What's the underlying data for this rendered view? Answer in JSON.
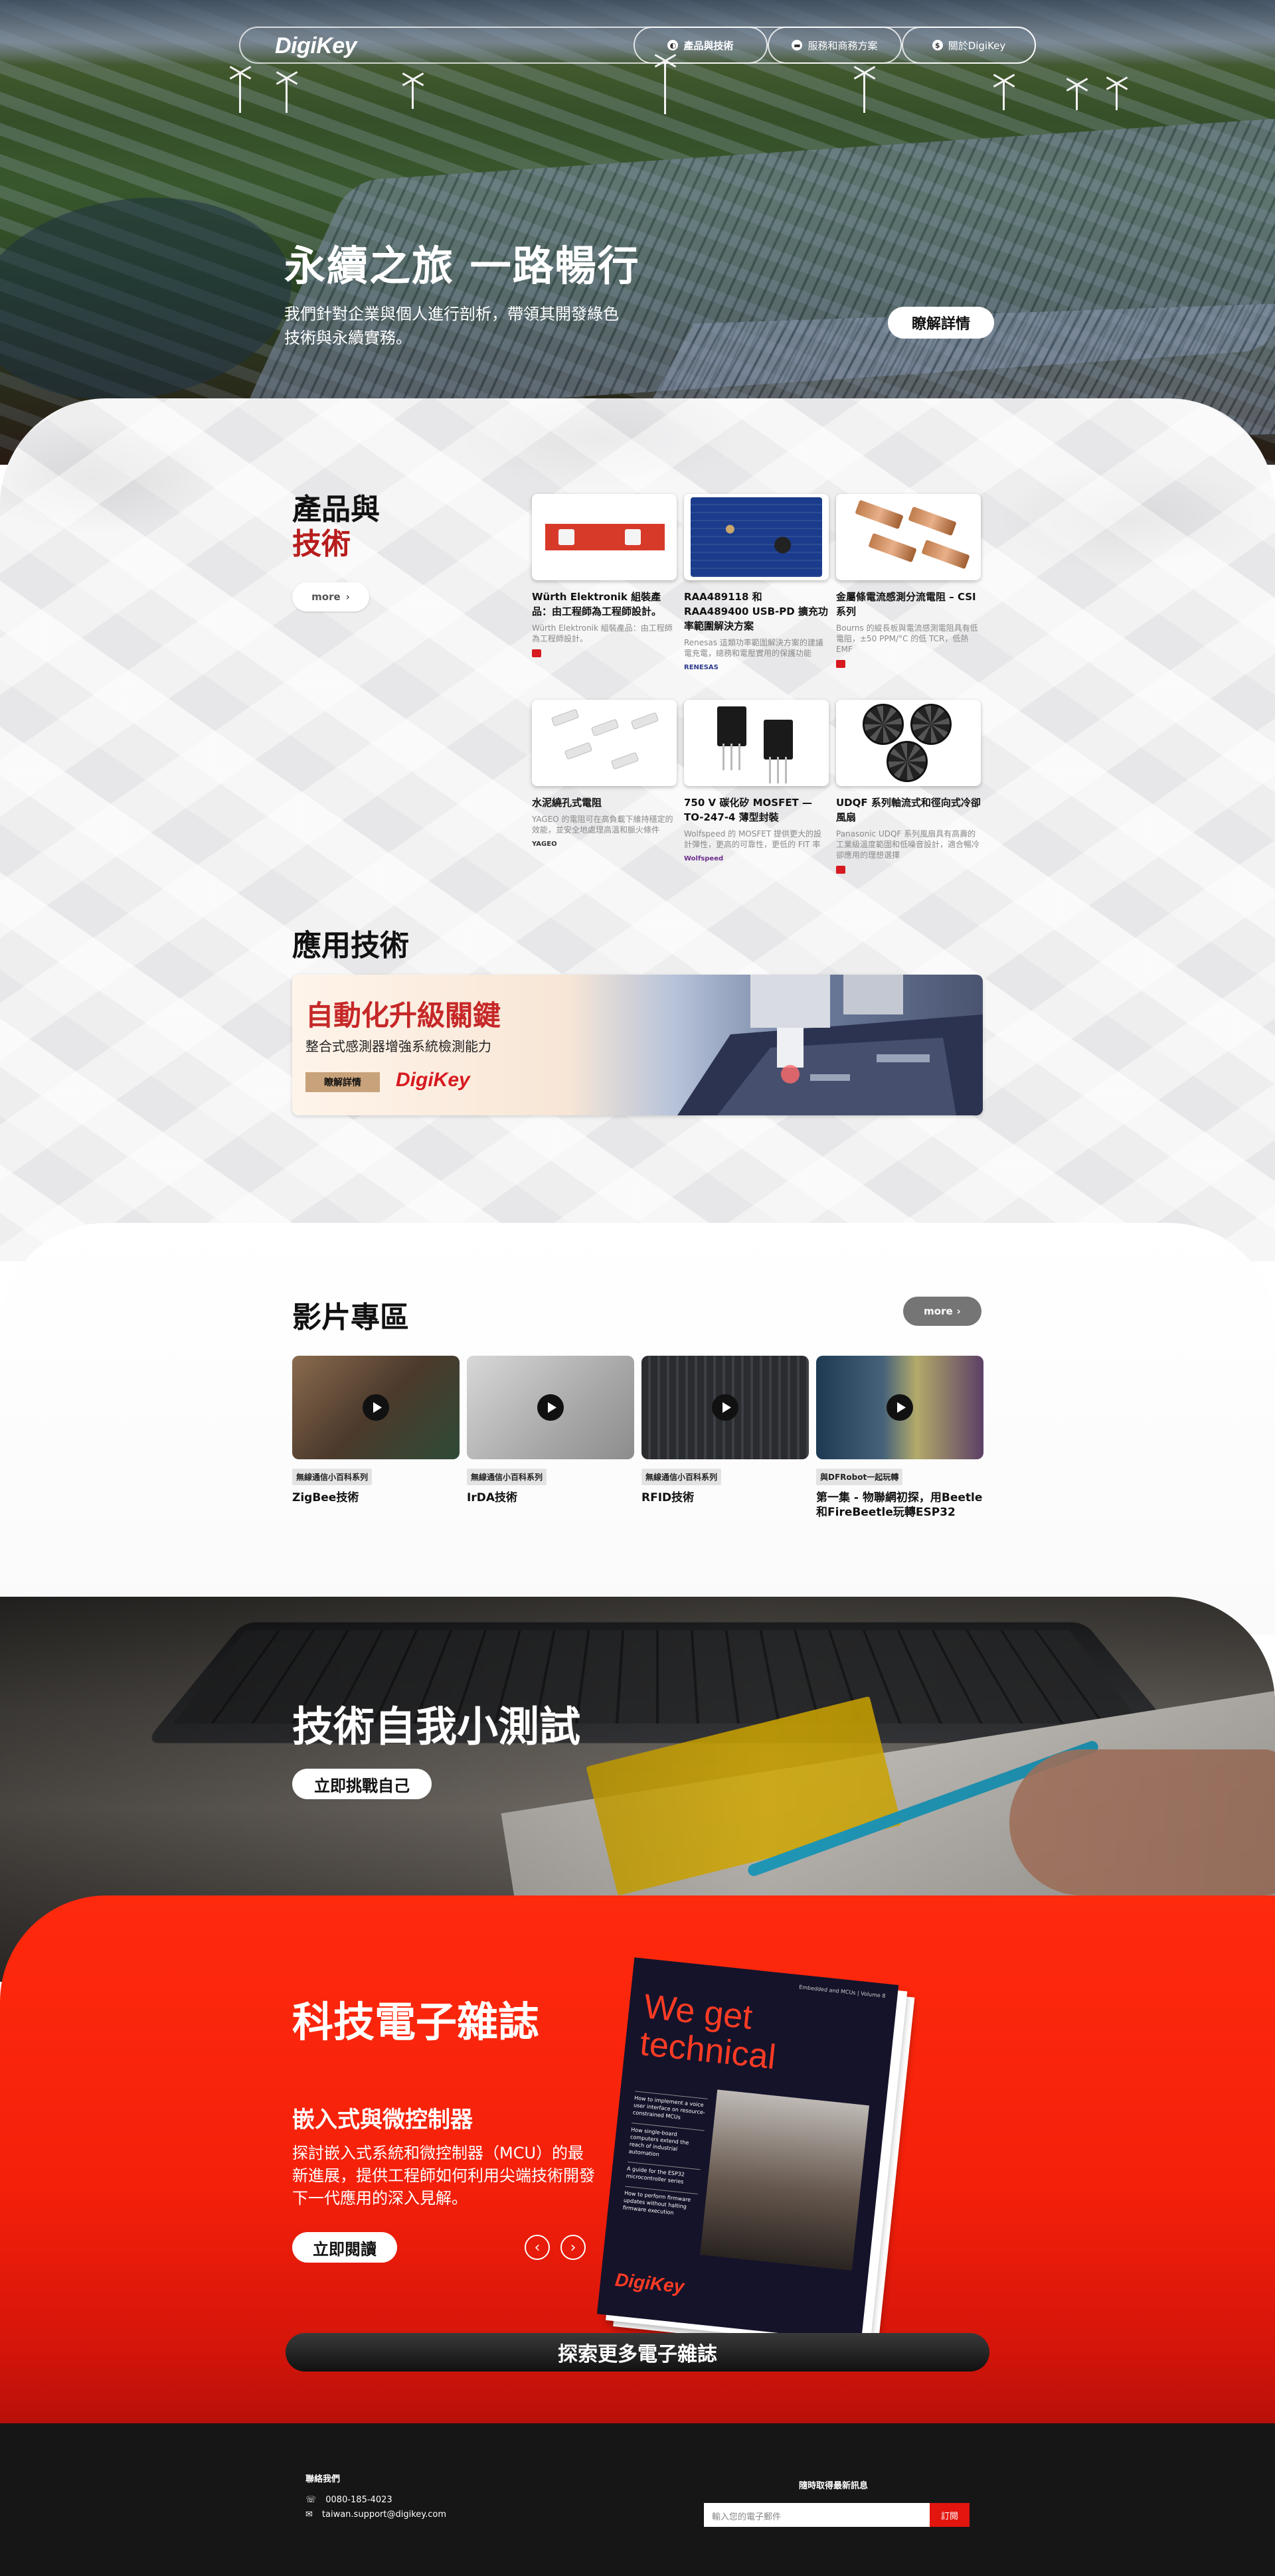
{
  "nav": {
    "logo": "DigiKey",
    "items": [
      "產品與技術",
      "服務和商務方案",
      "關於DigiKey"
    ],
    "item_icons": [
      "globe-icon",
      "chat-icon",
      "dollar-icon"
    ]
  },
  "hero": {
    "title": "永續之旅 一路暢行",
    "subtitle": "我們針對企業與個人進行剖析，帶領其開發綠色技術與永續實務。",
    "cta": "瞭解詳情"
  },
  "products": {
    "title_line1": "產品與",
    "title_line2": "技術",
    "more": "more",
    "cards": [
      {
        "title": "Würth Elektronik 組裝產品：由工程師為工程師設計。",
        "desc": "Würth Elektronik 組裝產品：由工程師為工程師設計。",
        "brand": "Würth Elektronik"
      },
      {
        "title": "RAA489118 和 RAA489400 USB-PD 擴充功率範圍解決方案",
        "desc": "Renesas 這類功率範圍解決方案的建議電充電，總務和電壓實用的保護功能",
        "brand": "RENESAS"
      },
      {
        "title": "金屬條電流感測分流電阻 – CSI 系列",
        "desc": "Bourns 的縱長板與電流感測電阻具有低電阻，±50 PPM/°C 的低 TCR，低熱 EMF",
        "brand": "BOURNS"
      },
      {
        "title": "水泥繞孔式電阻",
        "desc": "YAGEO 的電阻可在高負載下維持穩定的效能，並安全地處理高溫和脈火條件",
        "brand": "YAGEO"
      },
      {
        "title": "750 V 碳化矽 MOSFET — TO-247-4 薄型封裝",
        "desc": "Wolfspeed 的 MOSFET 提供更大的設計彈性，更高的可靠性，更低的 FIT 率",
        "brand": "Wolfspeed"
      },
      {
        "title": "UDQF 系列軸流式和徑向式冷卻風扇",
        "desc": "Panasonic UDQF 系列風扇具有高壽的工業級溫度範圍和低噪音設計，適合暢冷卻應用的理想選擇",
        "brand": "Panasonic"
      }
    ]
  },
  "applications": {
    "title": "應用技術",
    "banner_title": "自動化升級關鍵",
    "banner_subtitle": "整合式感測器增強系統檢測能力",
    "banner_button": "瞭解詳情",
    "banner_logo": "DigiKey"
  },
  "videos": {
    "title": "影片專區",
    "more": "more",
    "items": [
      {
        "tag": "無線通信小百科系列",
        "title": "ZigBee技術"
      },
      {
        "tag": "無線通信小百科系列",
        "title": "IrDA技術"
      },
      {
        "tag": "無線通信小百科系列",
        "title": "RFID技術"
      },
      {
        "tag": "與DFRobot一起玩轉",
        "title": "第一集 - 物聯網初探，用Beetle和FireBeetle玩轉ESP32"
      }
    ]
  },
  "quiz": {
    "title": "技術自我小測試",
    "button": "立即挑戰自己"
  },
  "magazine": {
    "title": "科技電子雜誌",
    "subtitle": "嵌入式與微控制器",
    "description": "探討嵌入式系統和微控制器（MCU）的最新進展，提供工程師如何利用尖端技術開發下一代應用的深入見解。",
    "button": "立即閱讀",
    "cover_title_line1": "We get",
    "cover_title_line2": "technical",
    "cover_edition": "Embedded and MCUs | Volume 8",
    "cover_items": [
      "How to implement a voice user interface on resource-constrained MCUs",
      "How single-board computers extend the reach of industrial automation",
      "A guide for the ESP32 microcontroller series",
      "How to perform firmware updates without halting firmware execution"
    ],
    "cover_logo": "DigiKey",
    "explore": "探索更多電子雜誌"
  },
  "footer": {
    "contact_title": "聯絡我們",
    "phone": "0080-185-4023",
    "email": "taiwan.support@digikey.com",
    "newsletter_title": "隨時取得最新訊息",
    "email_placeholder": "輸入您的電子郵件",
    "subscribe": "訂閱"
  },
  "colors": {
    "brand_red": "#d71920",
    "magazine_red": "#f4200a",
    "footer_bg": "#161616"
  }
}
